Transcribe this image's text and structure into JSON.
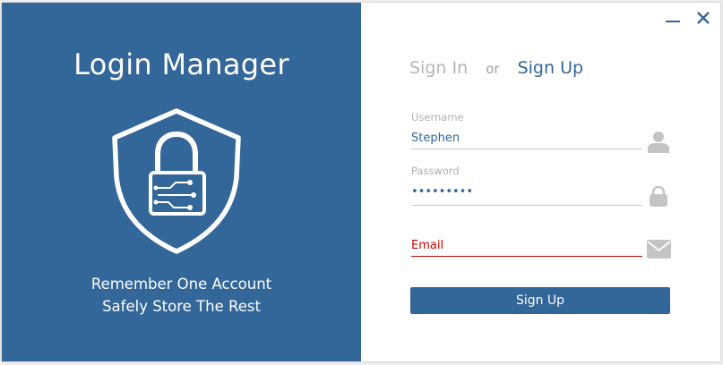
{
  "window": {
    "minimize_icon": "minimize-icon",
    "close_icon": "close-icon"
  },
  "brand": {
    "title": "Login Manager",
    "emblem_icon": "shield-lock-icon",
    "tagline_line1": "Remember One Account",
    "tagline_line2": "Safely Store The Rest"
  },
  "auth": {
    "tab_sign_in": "Sign In",
    "tab_separator": "or",
    "tab_sign_up": "Sign Up",
    "active_tab": "Sign Up"
  },
  "form": {
    "username": {
      "label": "Username",
      "value": "Stephen",
      "icon": "user-icon"
    },
    "password": {
      "label": "Password",
      "masked_value": "•••••••••",
      "icon": "lock-icon"
    },
    "email": {
      "placeholder": "Email",
      "value": "",
      "icon": "envelope-icon",
      "state": "error"
    },
    "submit_label": "Sign Up"
  },
  "colors": {
    "brand_blue": "#336699",
    "error_red": "#cc0000",
    "muted_gray": "#b5b5b5"
  }
}
